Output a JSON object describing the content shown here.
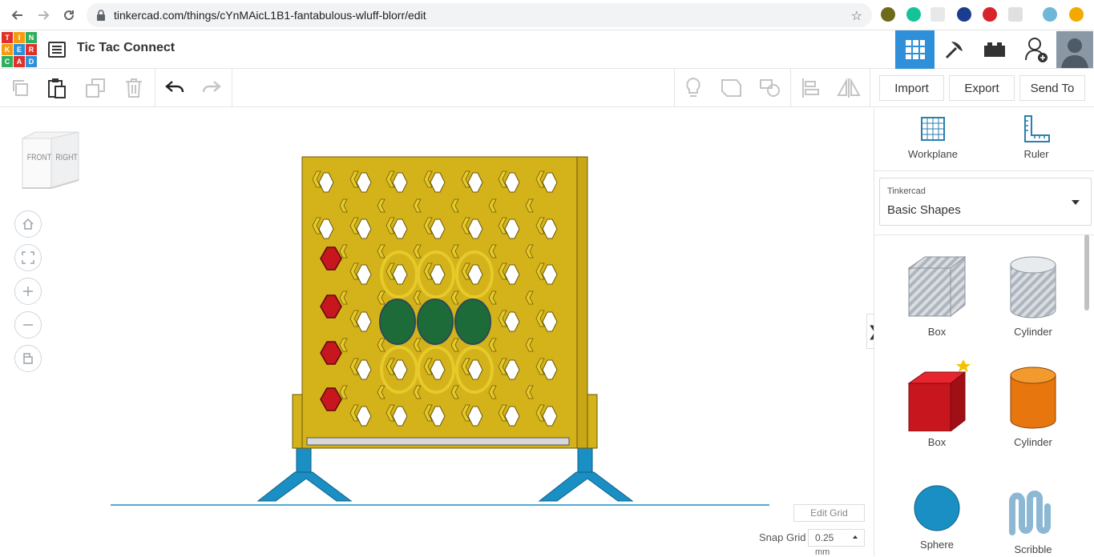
{
  "browser": {
    "url": "tinkercad.com/things/cYnMAicL1B1-fantabulous-wluff-blorr/edit"
  },
  "header": {
    "logo_letters": [
      "TIN",
      "KER",
      "CAD"
    ],
    "title": "Tic Tac Connect"
  },
  "toolbar": {
    "import_label": "Import",
    "export_label": "Export",
    "send_to_label": "Send To"
  },
  "viewcube": {
    "front": "FRONT",
    "right": "RIGHT"
  },
  "workspace": {
    "edit_grid_label": "Edit Grid",
    "snap_grid_label": "Snap Grid",
    "snap_grid_value": "0.25",
    "snap_grid_unit": "mm"
  },
  "panel": {
    "workplane_label": "Workplane",
    "ruler_label": "Ruler",
    "library_source": "Tinkercad",
    "library_name": "Basic Shapes",
    "shapes": [
      {
        "label": "Box"
      },
      {
        "label": "Cylinder"
      },
      {
        "label": "Box"
      },
      {
        "label": "Cylinder"
      },
      {
        "label": "Sphere"
      },
      {
        "label": "Scribble"
      }
    ]
  },
  "colors": {
    "accent": "#2f8fd8",
    "board_yellow": "#d4b21a",
    "stand_blue": "#1a8fc4",
    "piece_red": "#c8161e",
    "piece_green": "#1e6b3a"
  }
}
